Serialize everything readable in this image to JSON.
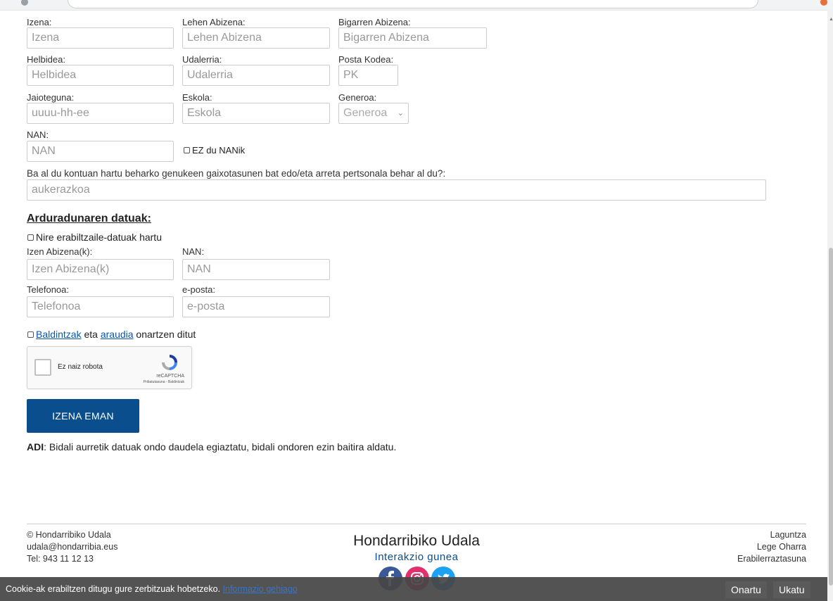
{
  "form": {
    "izena": {
      "label": "Izena:",
      "placeholder": "Izena"
    },
    "lehen_abizena": {
      "label": "Lehen Abizena:",
      "placeholder": "Lehen Abizena"
    },
    "bigarren_abizena": {
      "label": "Bigarren Abizena:",
      "placeholder": "Bigarren Abizena"
    },
    "helbidea": {
      "label": "Helbidea:",
      "placeholder": "Helbidea"
    },
    "udalerria": {
      "label": "Udalerria:",
      "placeholder": "Udalerria"
    },
    "posta_kodea": {
      "label": "Posta Kodea:",
      "placeholder": "PK"
    },
    "jaioteguna": {
      "label": "Jaioteguna:",
      "placeholder": "uuuu-hh-ee"
    },
    "eskola": {
      "label": "Eskola:",
      "placeholder": "Eskola"
    },
    "generoa": {
      "label": "Generoa:",
      "selected": "Generoa"
    },
    "nan": {
      "label": "NAN:",
      "placeholder": "NAN"
    },
    "ez_nan_label": "EZ du NANik",
    "gaixotasuna": {
      "label": "Ba al du kontuan hartu beharko genukeen gaixotasunen bat edo/eta arreta pertsonala behar al du?:",
      "placeholder": "aukerazkoa"
    }
  },
  "arduraduna": {
    "title": "Arduradunaren datuak:",
    "own_data_label": "Nire erabiltzaile-datuak hartu",
    "izen_abizenak": {
      "label": "Izen Abizena(k):",
      "placeholder": "Izen Abizena(k)"
    },
    "nan": {
      "label": "NAN:",
      "placeholder": "NAN"
    },
    "telefonoa": {
      "label": "Telefonoa:",
      "placeholder": "Telefonoa"
    },
    "eposta": {
      "label": "e-posta:",
      "placeholder": "e-posta"
    }
  },
  "terms": {
    "link1": "Baldintzak",
    "middle": " eta ",
    "link2": "araudia",
    "suffix": " onartzen ditut"
  },
  "recaptcha": {
    "label": "Ez naiz robota",
    "brand": "reCAPTCHA",
    "terms": "Pribatutasuna - Baldintzak"
  },
  "submit_label": "IZENA EMAN",
  "notice": {
    "bold": "ADI",
    "text": ": Bidali aurretik datuak ondo daudela egiaztatu, bidali ondoren ezin baitira aldatu."
  },
  "footer": {
    "copyright": "© Hondarribiko Udala",
    "email": "udala@hondarribia.eus",
    "phone": "Tel: 943 11 12 13",
    "brand_title": "Hondarribiko Udala",
    "brand_subtitle": "Interakzio gunea",
    "links": [
      "Laguntza",
      "Lege Oharra",
      "Erabilerraztasuna"
    ]
  },
  "cookie": {
    "text": "Cookie-ak erabiltzen ditugu gure zerbitzuak hobetzeko.",
    "link": "Informazio gehiago",
    "accept": "Onartu",
    "reject": "Ukatu"
  },
  "colors": {
    "primary": "#0b4e8e",
    "link": "#0b56a5",
    "facebook": "#3b5998",
    "instagram": "#e1306c",
    "twitter": "#1da1f2",
    "cookie_bar": "#464646"
  }
}
